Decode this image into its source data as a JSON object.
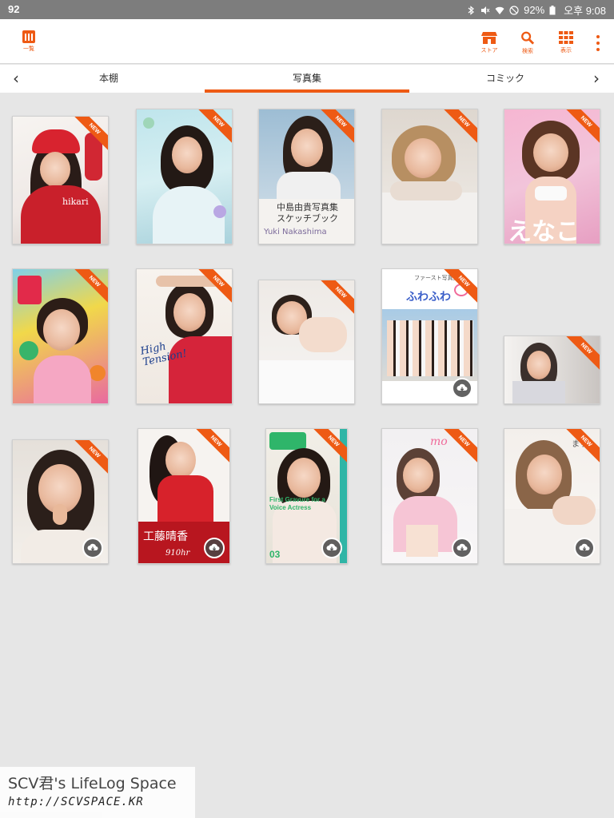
{
  "status_bar": {
    "left_text": "92",
    "battery": "92%",
    "time": "오후 9:08",
    "icons": [
      "bluetooth-icon",
      "mute-icon",
      "wifi-icon",
      "dnd-icon",
      "battery-icon"
    ]
  },
  "app_bar": {
    "library_label": "一覧",
    "actions": [
      {
        "id": "store",
        "label": "ストア",
        "icon": "store-icon"
      },
      {
        "id": "search",
        "label": "検索",
        "icon": "search-icon"
      },
      {
        "id": "display",
        "label": "表示",
        "icon": "grid-icon"
      }
    ],
    "more_icon": "more-vert-icon"
  },
  "tabs": {
    "items": [
      "本棚",
      "写真集",
      "コミック"
    ],
    "active_index": 1
  },
  "accent_color": "#ee5a14",
  "new_badge": "NEW",
  "books": [
    {
      "cover_text": "hikari",
      "is_new": true,
      "downloaded": true
    },
    {
      "cover_text": "",
      "is_new": true,
      "downloaded": true
    },
    {
      "cover_text": "中島由貴写真集\nスケッチブック",
      "cover_sub": "Yuki Nakashima",
      "is_new": true,
      "downloaded": true
    },
    {
      "cover_text": "",
      "is_new": true,
      "downloaded": true
    },
    {
      "cover_text": "えなこ",
      "is_new": true,
      "downloaded": true
    },
    {
      "cover_text": "",
      "is_new": true,
      "downloaded": true
    },
    {
      "cover_text": "High Tension!",
      "is_new": true,
      "downloaded": true
    },
    {
      "cover_text": "",
      "is_new": true,
      "downloaded": true
    },
    {
      "cover_text": "ふわふわ",
      "cover_sub": "ファースト写真集",
      "is_new": true,
      "downloaded": false
    },
    {
      "cover_text": "",
      "is_new": true,
      "downloaded": true
    },
    {
      "cover_text": "",
      "is_new": true,
      "downloaded": false
    },
    {
      "cover_text": "工藤晴香",
      "cover_sub": "910hr",
      "is_new": true,
      "downloaded": false
    },
    {
      "cover_text": "First Gravure for a Voice Actress",
      "cover_sub": "03",
      "is_new": true,
      "downloaded": false
    },
    {
      "cover_text": "mo",
      "is_new": true,
      "downloaded": false
    },
    {
      "cover_text": "まり",
      "is_new": true,
      "downloaded": false
    }
  ],
  "watermark": {
    "line1": "SCV君's LifeLog Space",
    "line2": "http://SCVSPACE.KR"
  }
}
